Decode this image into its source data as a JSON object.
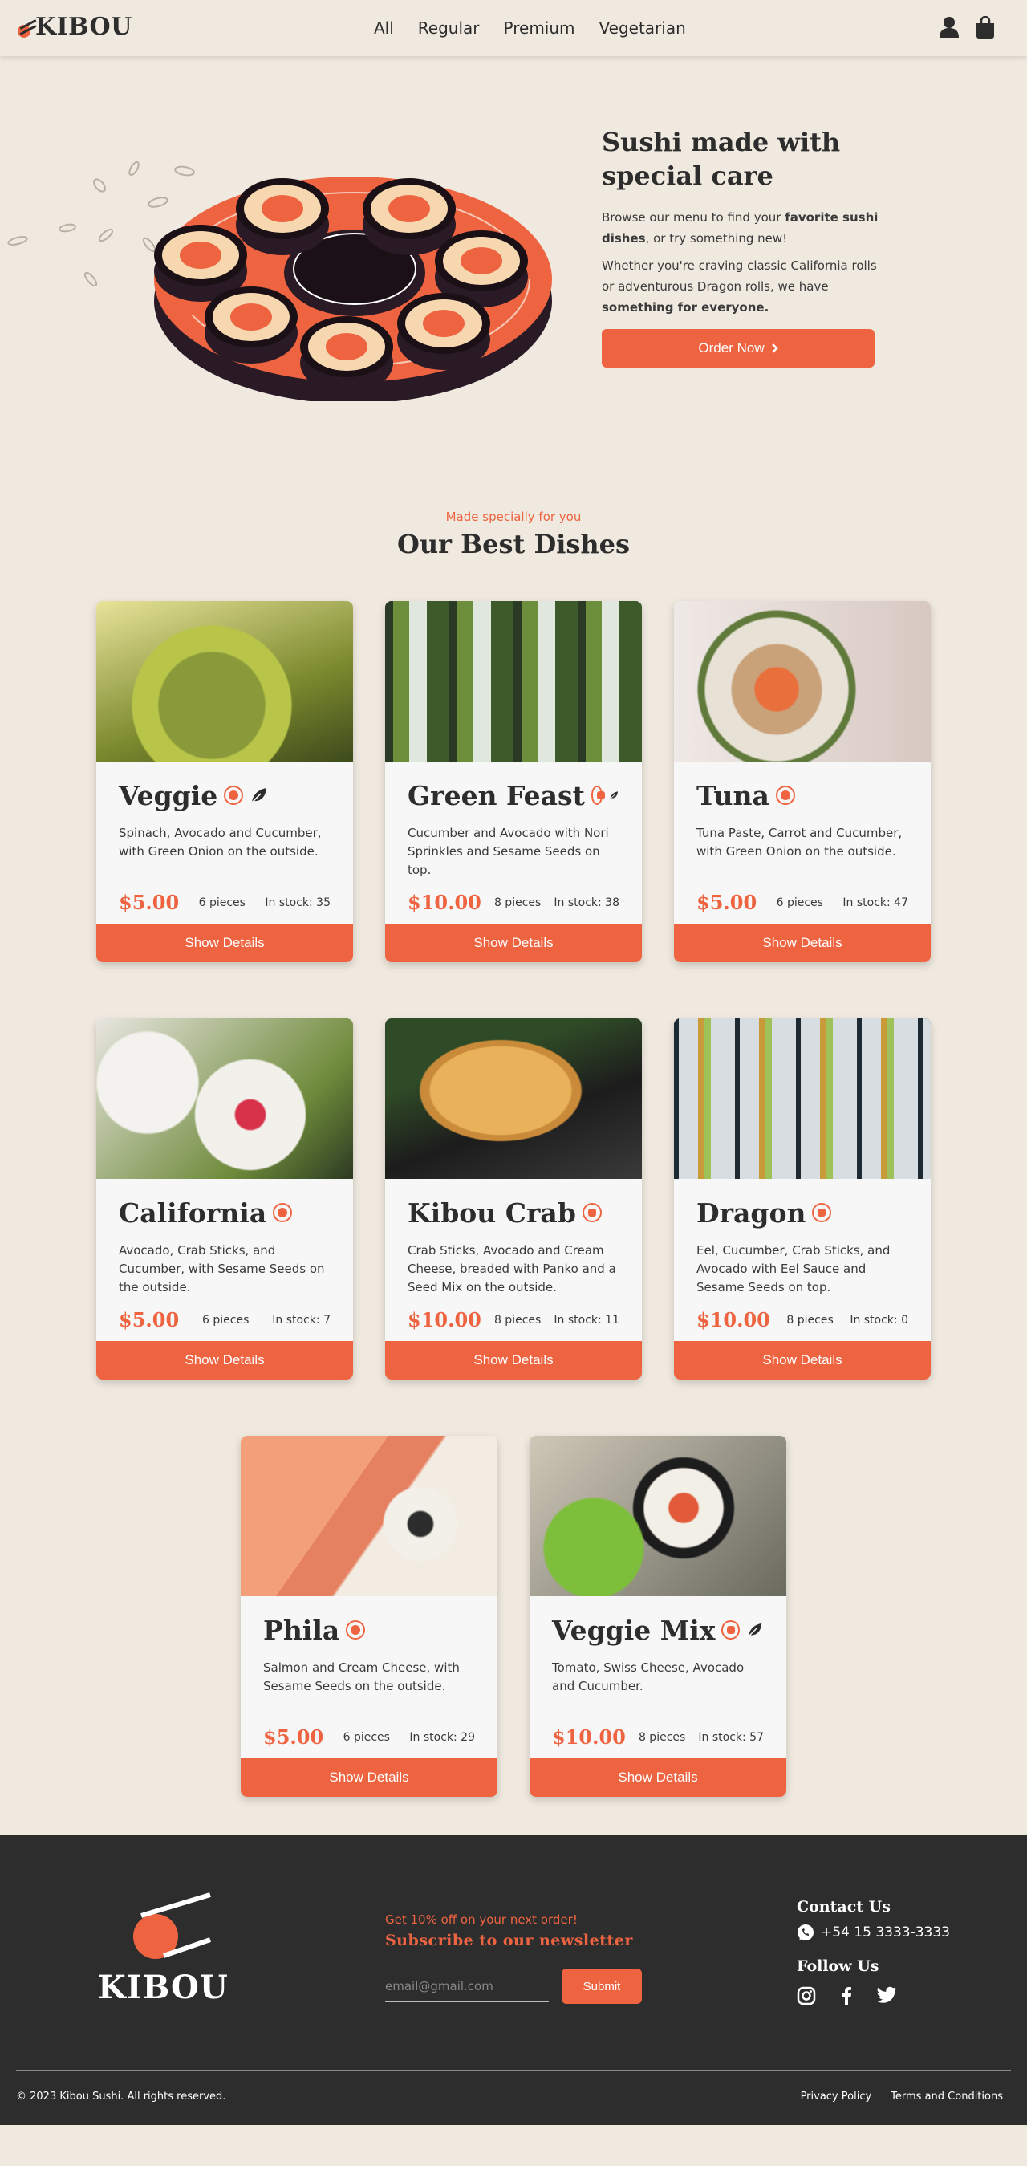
{
  "brand": {
    "name": "KIBOU",
    "accent": "#ee6441",
    "dark": "#2d2d2d",
    "background": "#efe9df"
  },
  "nav": {
    "links": [
      "All",
      "Regular",
      "Premium",
      "Vegetarian"
    ],
    "icons": [
      "user-icon",
      "shopping-bag-icon"
    ]
  },
  "hero": {
    "title": "Sushi made with special care",
    "p1_a": "Browse our menu to find your ",
    "p1_b": "favorite sushi dishes",
    "p1_c": ", or try something new!",
    "p2_a": "Whether you're craving classic California rolls or adventurous Dragon rolls, we have ",
    "p2_b": "something for everyone.",
    "button": "Order Now"
  },
  "section": {
    "subtitle": "Made specially for you",
    "title": "Our Best Dishes"
  },
  "dishes": [
    {
      "name": "Veggie",
      "desc": "Spinach, Avocado and Cucumber, with Green Onion on the outside.",
      "price": "$5.00",
      "pieces": "6 pieces",
      "stock": "In stock: 35",
      "button": "Show Details",
      "icons": [
        "sushi-icon",
        "leaf-icon"
      ]
    },
    {
      "name": "Green Feast",
      "desc": "Cucumber and Avocado with Nori Sprinkles and Sesame Seeds on top.",
      "price": "$10.00",
      "pieces": "8 pieces",
      "stock": "In stock: 38",
      "button": "Show Details",
      "icons": [
        "premium-icon",
        "leaf-icon"
      ]
    },
    {
      "name": "Tuna",
      "desc": "Tuna Paste, Carrot and Cucumber, with Green Onion on the outside.",
      "price": "$5.00",
      "pieces": "6 pieces",
      "stock": "In stock: 47",
      "button": "Show Details",
      "icons": [
        "sushi-icon"
      ]
    },
    {
      "name": "California",
      "desc": "Avocado, Crab Sticks, and Cucumber, with Sesame Seeds on the outside.",
      "price": "$5.00",
      "pieces": "6 pieces",
      "stock": "In stock: 7",
      "button": "Show Details",
      "icons": [
        "sushi-icon"
      ]
    },
    {
      "name": "Kibou Crab",
      "desc": "Crab Sticks, Avocado and Cream Cheese, breaded with Panko and a Seed Mix on the outside.",
      "price": "$10.00",
      "pieces": "8 pieces",
      "stock": "In stock: 11",
      "button": "Show Details",
      "icons": [
        "premium-icon"
      ]
    },
    {
      "name": "Dragon",
      "desc": "Eel, Cucumber, Crab Sticks, and Avocado with Eel Sauce and Sesame Seeds on top.",
      "price": "$10.00",
      "pieces": "8 pieces",
      "stock": "In stock: 0",
      "button": "Show Details",
      "icons": [
        "premium-icon"
      ]
    },
    {
      "name": "Phila",
      "desc": "Salmon and Cream Cheese, with Sesame Seeds on the outside.",
      "price": "$5.00",
      "pieces": "6 pieces",
      "stock": "In stock: 29",
      "button": "Show Details",
      "icons": [
        "sushi-icon"
      ]
    },
    {
      "name": "Veggie Mix",
      "desc": "Tomato, Swiss Cheese, Avocado and Cucumber.",
      "price": "$10.00",
      "pieces": "8 pieces",
      "stock": "In stock: 57",
      "button": "Show Details",
      "icons": [
        "premium-icon",
        "leaf-icon"
      ]
    }
  ],
  "footer": {
    "logo_text": "KIBOU",
    "promo_sub": "Get 10% off on your next order!",
    "promo_title": "Subscribe to our newsletter",
    "email_placeholder": "email@gmail.com",
    "submit": "Submit",
    "contact_title": "Contact Us",
    "phone": "+54 15 3333-3333",
    "follow_title": "Follow Us",
    "social_icons": [
      "instagram-icon",
      "facebook-icon",
      "twitter-icon"
    ],
    "copyright": "© 2023 Kibou Sushi. All rights reserved.",
    "privacy": "Privacy Policy",
    "terms": "Terms and Conditions"
  }
}
